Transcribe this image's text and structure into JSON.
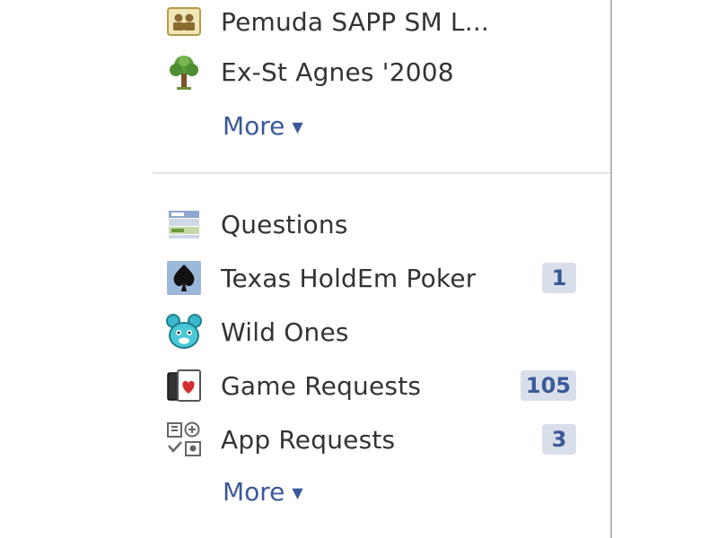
{
  "groups": {
    "items": [
      {
        "label": "Pemuda SAPP SM L...",
        "icon": "group-icon"
      },
      {
        "label": "Ex-St Agnes '2008",
        "icon": "tree-icon"
      }
    ],
    "more_label": "More"
  },
  "apps": {
    "items": [
      {
        "label": "Questions",
        "icon": "questions-icon",
        "badge": null
      },
      {
        "label": "Texas HoldEm Poker",
        "icon": "poker-spade-icon",
        "badge": "1"
      },
      {
        "label": "Wild Ones",
        "icon": "wild-ones-icon",
        "badge": null
      },
      {
        "label": "Game Requests",
        "icon": "game-cards-icon",
        "badge": "105"
      },
      {
        "label": "App Requests",
        "icon": "app-requests-icon",
        "badge": "3"
      }
    ],
    "more_label": "More"
  },
  "colors": {
    "link": "#3b5998",
    "badge_bg": "#d8dfea",
    "text": "#333333",
    "divider": "#e5e5e5"
  }
}
